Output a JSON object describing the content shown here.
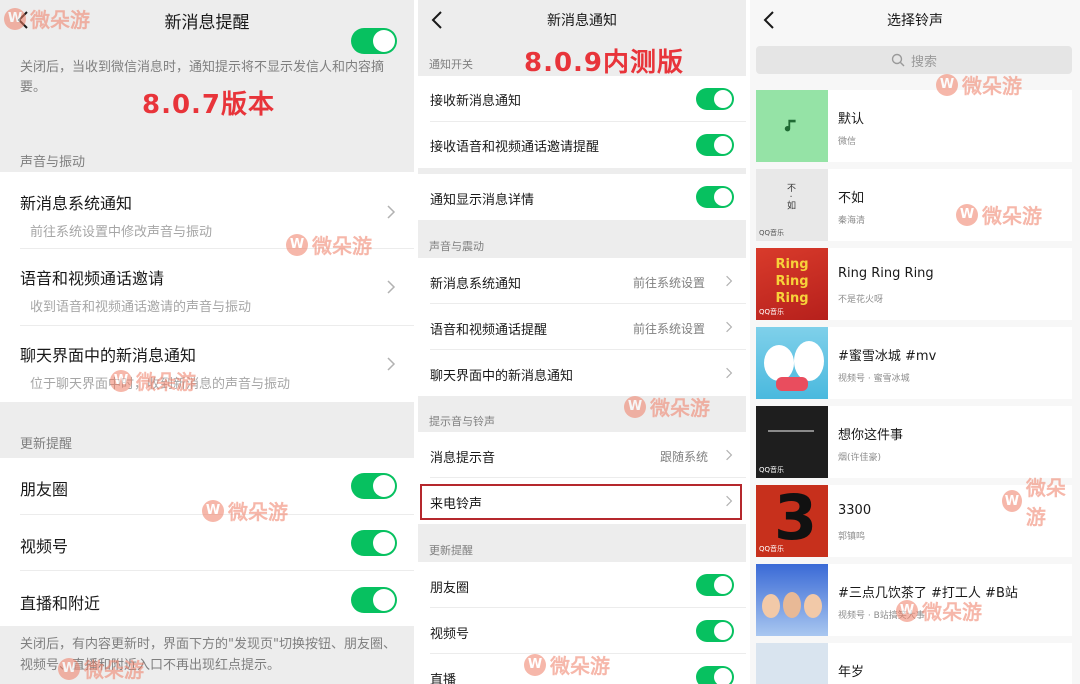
{
  "watermark": "微朵游",
  "panel1": {
    "title": "新消息提醒",
    "version_label": "8.0.7版本",
    "top_desc": "关闭后，当收到微信消息时，通知提示将不显示发信人和内容摘要。",
    "section_sound": "声音与振动",
    "items": [
      {
        "title": "新消息系统通知",
        "sub": "前往系统设置中修改声音与振动"
      },
      {
        "title": "语音和视频通话邀请",
        "sub": "收到语音和视频通话邀请的声音与振动"
      },
      {
        "title": "聊天界面中的新消息通知",
        "sub": "位于聊天界面中时，收到新消息的声音与振动"
      }
    ],
    "section_update": "更新提醒",
    "toggles": [
      {
        "label": "朋友圈",
        "on": true
      },
      {
        "label": "视频号",
        "on": true
      },
      {
        "label": "直播和附近",
        "on": true
      }
    ],
    "bottom_desc": "关闭后，有内容更新时，界面下方的\"发现页\"切换按钮、朋友圈、视频号、直播和附近入口不再出现红点提示。"
  },
  "panel2": {
    "title": "新消息通知",
    "version_label": "8.0.9内测版",
    "section_switch": "通知开关",
    "switches": [
      {
        "label": "接收新消息通知",
        "on": true
      },
      {
        "label": "接收语音和视频通话邀请提醒",
        "on": true
      },
      {
        "label": "通知显示消息详情",
        "on": true
      }
    ],
    "section_sound": "声音与震动",
    "sound_items": [
      {
        "label": "新消息系统通知",
        "value": "前往系统设置"
      },
      {
        "label": "语音和视频通话提醒",
        "value": "前往系统设置"
      },
      {
        "label": "聊天界面中的新消息通知",
        "value": ""
      }
    ],
    "section_tone": "提示音与铃声",
    "tone_items": [
      {
        "label": "消息提示音",
        "value": "跟随系统"
      },
      {
        "label": "来电铃声",
        "value": ""
      }
    ],
    "section_update": "更新提醒",
    "update_toggles": [
      {
        "label": "朋友圈",
        "on": true
      },
      {
        "label": "视频号",
        "on": true
      },
      {
        "label": "直播",
        "on": true
      }
    ]
  },
  "panel3": {
    "title": "选择铃声",
    "search_placeholder": "搜索",
    "ringtones": [
      {
        "name": "默认",
        "source": "微信"
      },
      {
        "name": "不如",
        "source": "秦海清"
      },
      {
        "name": "Ring Ring Ring",
        "source": "不是花火呀"
      },
      {
        "name": "#蜜雪冰城 #mv",
        "source": "视频号 · 蜜雪冰城"
      },
      {
        "name": "想你这件事",
        "source": "烟(许佳豪)"
      },
      {
        "name": "3300",
        "source": "郭镇鸣"
      },
      {
        "name": "#三点几饮茶了 #打工人 #B站",
        "source": "视频号 · B站搞笑大事"
      },
      {
        "name": "年岁",
        "source": ""
      }
    ],
    "thumb_texts": {
      "buru": "不 · 如",
      "ring": "Ring Ring Ring",
      "three": "3",
      "qq": "QQ音乐"
    }
  },
  "colors": {
    "toggle_on": "#07c160",
    "red_label": "#e8343a",
    "highlight": "#b5282d",
    "watermark": "#f07e65"
  }
}
